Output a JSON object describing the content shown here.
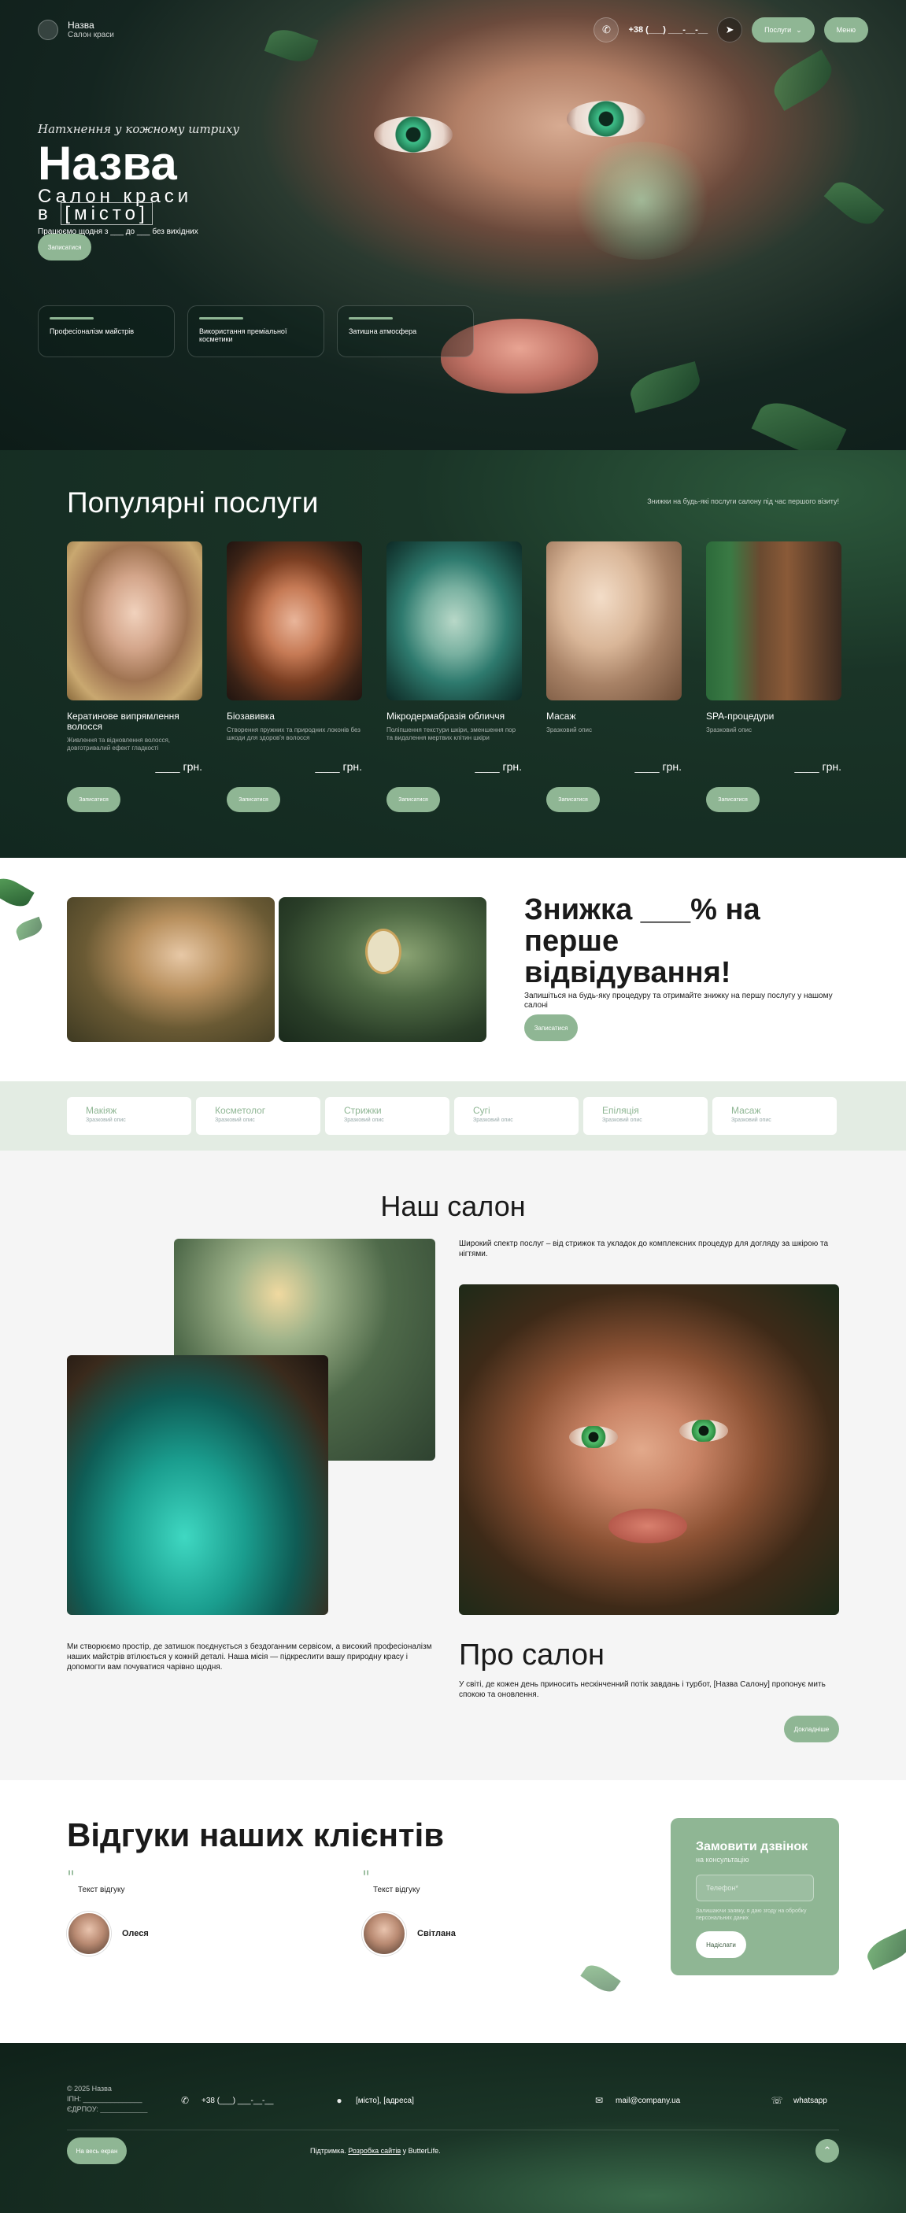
{
  "header": {
    "brand_title": "Назва",
    "brand_subtitle": "Салон краси",
    "phone": "+38 (___) ___-__-__",
    "services_menu_label": "Послуги",
    "menu_label": "Меню"
  },
  "hero": {
    "tagline": "Натхнення у кожному штриху",
    "title": "Назва",
    "subtitle_line1": "Салон краси",
    "subtitle_prefix": "в ",
    "subtitle_city": "[місто]",
    "hours": "Працюємо щодня з ___ до ___ без вихідних",
    "cta_label": "Записатися",
    "features": [
      "Професіоналізм майстрів",
      "Використання преміальної косметики",
      "Затишна атмосфера"
    ]
  },
  "services": {
    "title": "Популярні послуги",
    "note": "Знижки на будь-які послуги салону під час першого візиту!",
    "book_label": "Записатися",
    "items": [
      {
        "name": "Кератинове випрямлення волосся",
        "desc": "Живлення та відновлення волосся, довготривалий ефект гладкості",
        "price": "____ грн."
      },
      {
        "name": "Біозавивка",
        "desc": "Створення пружних та природних локонів без шкоди для здоров'я волосся",
        "price": "____ грн."
      },
      {
        "name": "Мікродермабразія обличчя",
        "desc": "Поліпшення текстури шкіри, зменшення пор та видалення мертвих клітин шкіри",
        "price": "____ грн."
      },
      {
        "name": "Масаж",
        "desc": "Зразковий опис",
        "price": "____ грн."
      },
      {
        "name": "SPA-процедури",
        "desc": "Зразковий опис",
        "price": "____ грн."
      }
    ]
  },
  "promo": {
    "title": "Знижка ___% на перше відвідування!",
    "text": "Запишіться на будь-яку процедуру та отримайте знижку на першу послугу у нашому салоні",
    "cta_label": "Записатися"
  },
  "categories": [
    {
      "name": "Макіяж",
      "desc": "Зразковий опис"
    },
    {
      "name": "Косметолог",
      "desc": "Зразковий опис"
    },
    {
      "name": "Стрижки",
      "desc": "Зразковий опис"
    },
    {
      "name": "Сугі",
      "desc": "Зразковий опис"
    },
    {
      "name": "Епіляція",
      "desc": "Зразковий опис"
    },
    {
      "name": "Масаж",
      "desc": "Зразковий опис"
    }
  ],
  "salon": {
    "title": "Наш салон",
    "top_text": "Широкий спектр послуг – від стрижок та укладок до комплексних процедур для догляду за шкірою та нігтями.",
    "left_text": "Ми створюємо простір, де затишок поєднується з бездоганним сервісом, а високий професіоналізм наших майстрів втілюється у кожній деталі. Наша місія — підкреслити вашу природну красу і допомогти вам почуватися чарівно щодня.",
    "about_title": "Про салон",
    "about_text": "У світі, де кожен день приносить нескінченний потік завдань і турбот, [Назва Салону] пропонує мить спокою та оновлення.",
    "more_label": "Докладніше"
  },
  "reviews": {
    "title": "Відгуки наших клієнтів",
    "items": [
      {
        "text": "Текст відгуку",
        "name": "Олеся"
      },
      {
        "text": "Текст відгуку",
        "name": "Світлана"
      }
    ]
  },
  "callback": {
    "title": "Замовити дзвінок",
    "subtitle": "на консультацію",
    "placeholder": "Телефон*",
    "note": "Залишаючи заявку, я даю згоду на обробку персональних даних",
    "submit_label": "Надіслати"
  },
  "footer": {
    "copyright": "© 2025 Назва",
    "ipn": "ІПН: _______________",
    "edrpou": "ЄДРПОУ: ____________",
    "phone": "+38 (___) ___-__-__",
    "address": "[місто], [адреса]",
    "email": "mail@company.ua",
    "messenger": "whatsapp",
    "button_label": "На весь екран",
    "support_prefix": "Підтримка. ",
    "support_link": "Розробка сайтів",
    "support_suffix": " у ButterLife."
  }
}
